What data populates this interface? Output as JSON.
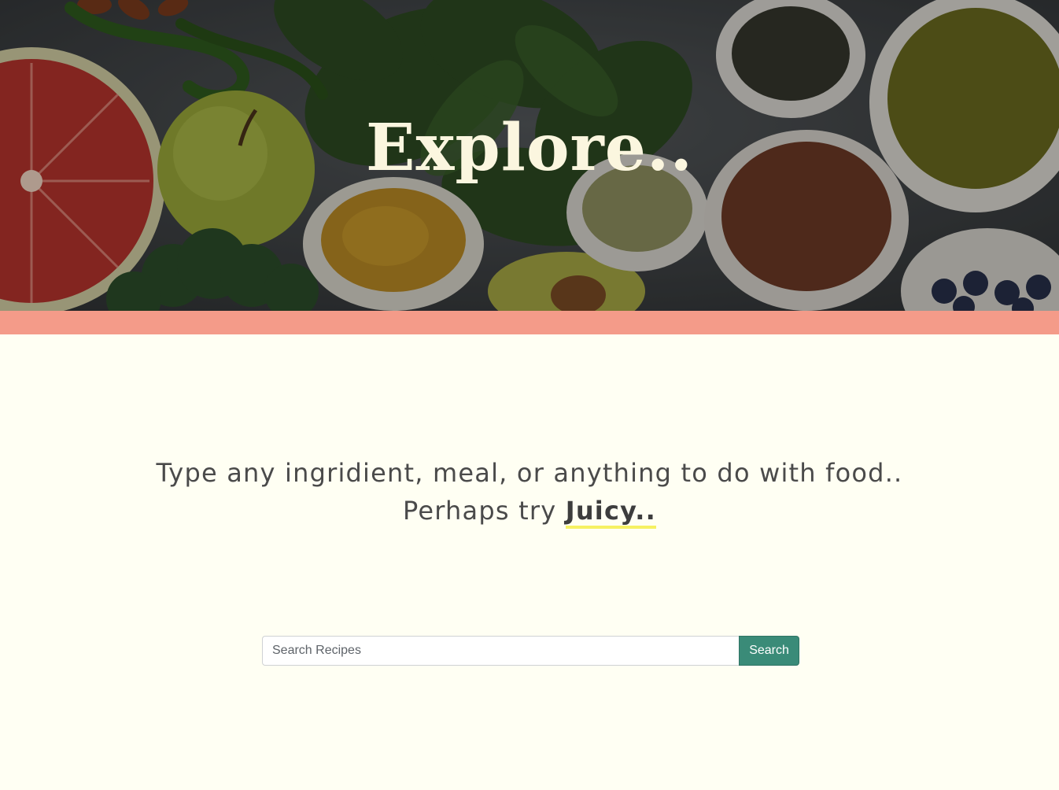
{
  "hero": {
    "title": "Explore..",
    "image_description_icon": "food-ingredients-banner"
  },
  "intro": {
    "line1": "Type any ingridient, meal, or anything to do with food..",
    "line2_prefix": "Perhaps try ",
    "suggestion": "Juicy.."
  },
  "search": {
    "placeholder": "Search Recipes",
    "value": "",
    "button_label": "Search"
  },
  "colors": {
    "background": "#fffff3",
    "band": "#f49b89",
    "button": "#3a8b78",
    "highlight_underline": "#f6f162",
    "title": "#fbf6df"
  }
}
